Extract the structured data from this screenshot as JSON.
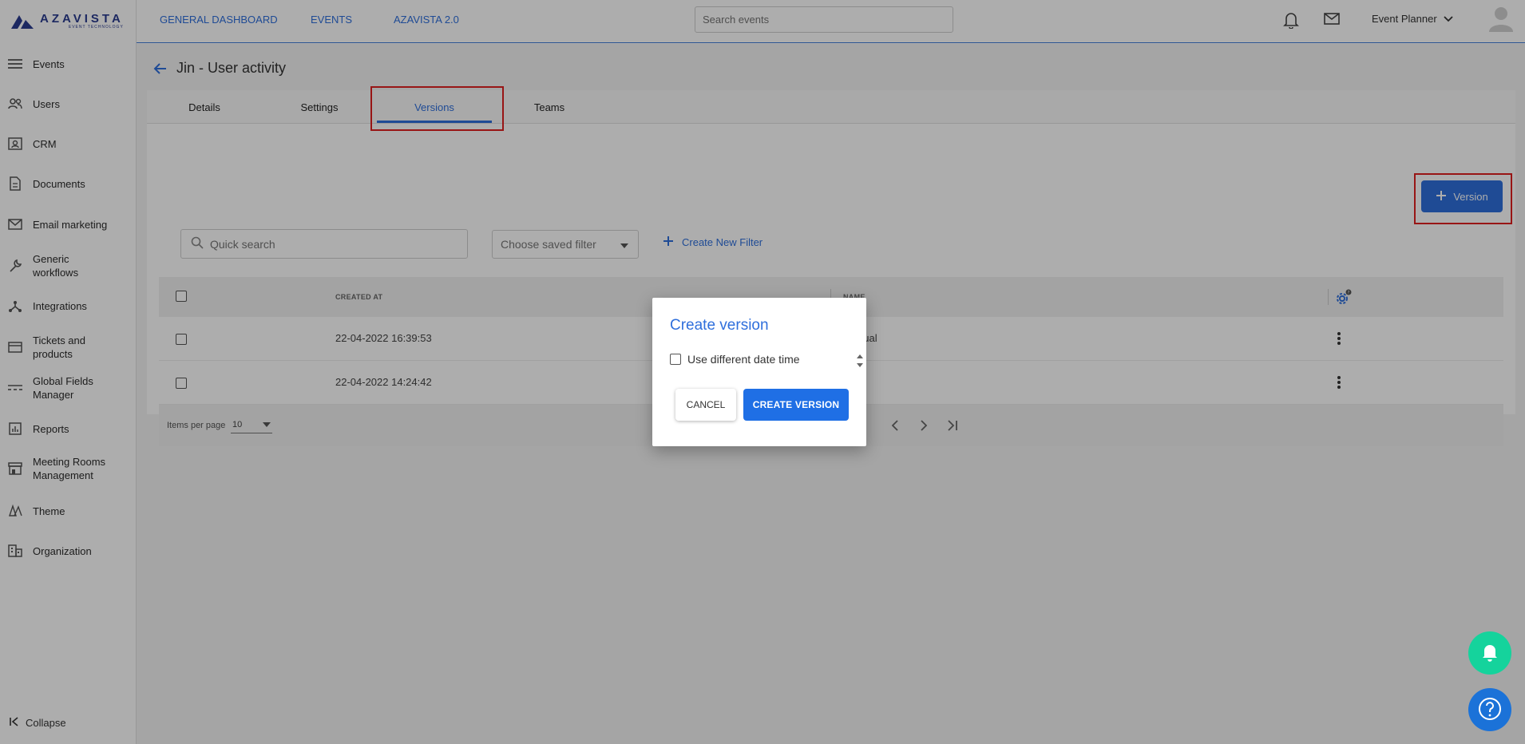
{
  "brand": {
    "name": "AZAVISTA",
    "tagline": "EVENT TECHNOLOGY"
  },
  "sidebar": {
    "items": [
      {
        "label": "Events",
        "icon": "events-icon"
      },
      {
        "label": "Users",
        "icon": "users-icon"
      },
      {
        "label": "CRM",
        "icon": "crm-icon"
      },
      {
        "label": "Documents",
        "icon": "document-icon"
      },
      {
        "label": "Email marketing",
        "icon": "mail-icon"
      },
      {
        "label": "Generic workflows",
        "icon": "wrench-icon"
      },
      {
        "label": "Integrations",
        "icon": "integrations-icon"
      },
      {
        "label": "Tickets and products",
        "icon": "ticket-icon"
      },
      {
        "label": "Global Fields Manager",
        "icon": "fields-icon"
      },
      {
        "label": "Reports",
        "icon": "reports-icon"
      },
      {
        "label": "Meeting Rooms Management",
        "icon": "meeting-rooms-icon"
      },
      {
        "label": "Theme",
        "icon": "theme-icon"
      },
      {
        "label": "Organization",
        "icon": "organization-icon"
      }
    ],
    "collapse_label": "Collapse"
  },
  "topbar": {
    "nav": [
      "GENERAL DASHBOARD",
      "EVENTS",
      "AZAVISTA 2.0"
    ],
    "search_placeholder": "Search events",
    "user_role": "Event Planner"
  },
  "page": {
    "title": "Jin - User activity",
    "tabs": [
      "Details",
      "Settings",
      "Versions",
      "Teams"
    ],
    "active_tab": "Versions",
    "add_version_label": "Version",
    "quick_search_placeholder": "Quick search",
    "saved_filter_placeholder": "Choose saved filter",
    "create_filter_label": "Create New Filter"
  },
  "table": {
    "columns": [
      "CREATED AT",
      "NAME"
    ],
    "rows": [
      {
        "created_at": "22-04-2022 16:39:53",
        "name": "manual"
      },
      {
        "created_at": "22-04-2022 14:24:42",
        "name": ""
      }
    ],
    "items_per_page_label": "Items per page",
    "items_per_page_value": "10"
  },
  "modal": {
    "title": "Create version",
    "checkbox_label": "Use different date time",
    "cancel_label": "CANCEL",
    "create_label": "CREATE VERSION"
  },
  "colors": {
    "accent": "#2f6fdc",
    "highlight": "#e02020",
    "notification_fab": "#15d39c",
    "help_fab": "#1b72d8"
  }
}
